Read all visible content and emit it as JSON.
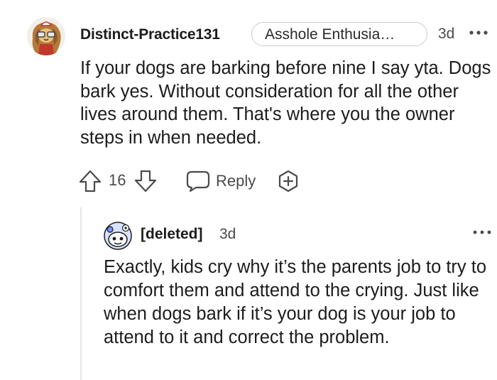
{
  "comment": {
    "username": "Distinct-Practice131",
    "flair": "Asshole Enthusia…",
    "age": "3d",
    "body": "If your dogs are barking before nine I say yta. Dogs bark yes. Without consideration for all the other lives around them. That's where you the owner steps in when needed.",
    "score": "16",
    "reply_label": "Reply"
  },
  "reply": {
    "username": "[deleted]",
    "age": "3d",
    "body": "Exactly, kids cry why it’s the parents job to try to comfort them and attend to the crying. Just like when dogs bark if it’s your dog is your job to attend to it and correct the problem."
  },
  "icons": {
    "upvote": "arrow-up-icon",
    "downvote": "arrow-down-icon",
    "reply": "speech-bubble-icon",
    "award": "award-plus-icon",
    "more": "ellipsis-icon"
  },
  "colors": {
    "text": "#1c1c1c",
    "meta": "#4a4a4a",
    "border": "#c9ccd0",
    "thread_line": "#e3e5e8",
    "reddit_blue": "#7193ff"
  }
}
